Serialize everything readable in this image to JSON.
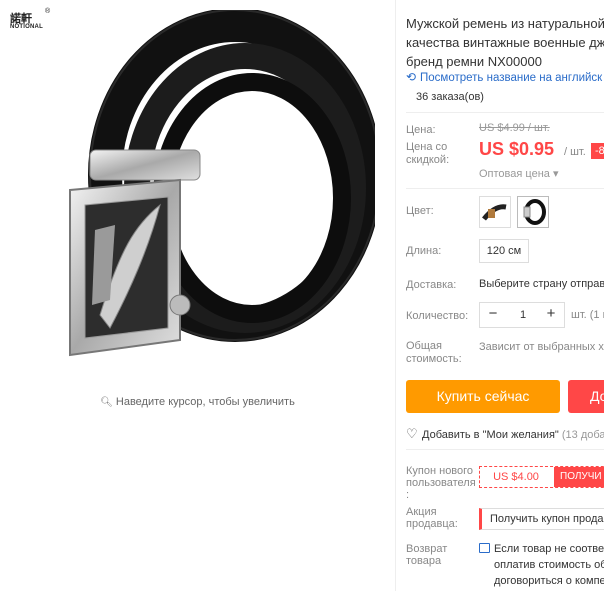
{
  "brand": {
    "name_cn": "諾軒",
    "name_en": "NOTIONAL",
    "registered": "®"
  },
  "image": {
    "zoom_hint": "Наведите курсор, чтобы увеличить"
  },
  "product": {
    "title_lines": [
      "Мужской ремень из натуральной",
      "качества винтажные военные дж",
      "бренд ремни NX00000"
    ],
    "translate_link": "Посмотреть название на английск",
    "orders": "36 заказа(ов)"
  },
  "price": {
    "label": "Цена:",
    "old_value": "US $4.99 / шт.",
    "discount_label": "Цена со скидкой:",
    "new_value": "US $0.95",
    "per_unit": "/ шт.",
    "discount_badge": "-8",
    "wholesale": "Оптовая цена ▾"
  },
  "options": {
    "color_label": "Цвет:",
    "length_label": "Длина:",
    "length_value": "120 см",
    "shipping_label": "Доставка:",
    "shipping_value": "Выберите страну отправк",
    "quantity_label": "Количество:",
    "quantity_value": "1",
    "quantity_minus": "−",
    "quantity_plus": "+",
    "quantity_unit": "шт. (1 ш",
    "total_label": "Общая стоимость:",
    "total_value": "Зависит от выбранных хар"
  },
  "actions": {
    "buy_now": "Купить сейчас",
    "add_to_cart": "До",
    "wishlist": "Добавить в \"Мои желания\"",
    "wishlist_count": "(13 добав"
  },
  "coupons": {
    "new_user_label": "Купон нового пользователя :",
    "new_user_amount": "US $4.00",
    "new_user_button": "ПОЛУЧИ",
    "seller_label": "Акция продавца:",
    "seller_button": "Получить купон продав"
  },
  "returns": {
    "label": "Возврат товара",
    "text_lines": [
      "Если товар не соответ",
      "оплатив стоимость об",
      "договориться о компе"
    ]
  },
  "colors": {
    "price_red": "#ff4747",
    "buy_orange": "#ff9a00",
    "link_blue": "#2a6cc9"
  },
  "icons": [
    "search-icon",
    "translate-icon",
    "heart-icon",
    "return-icon",
    "minus-icon",
    "plus-icon"
  ]
}
